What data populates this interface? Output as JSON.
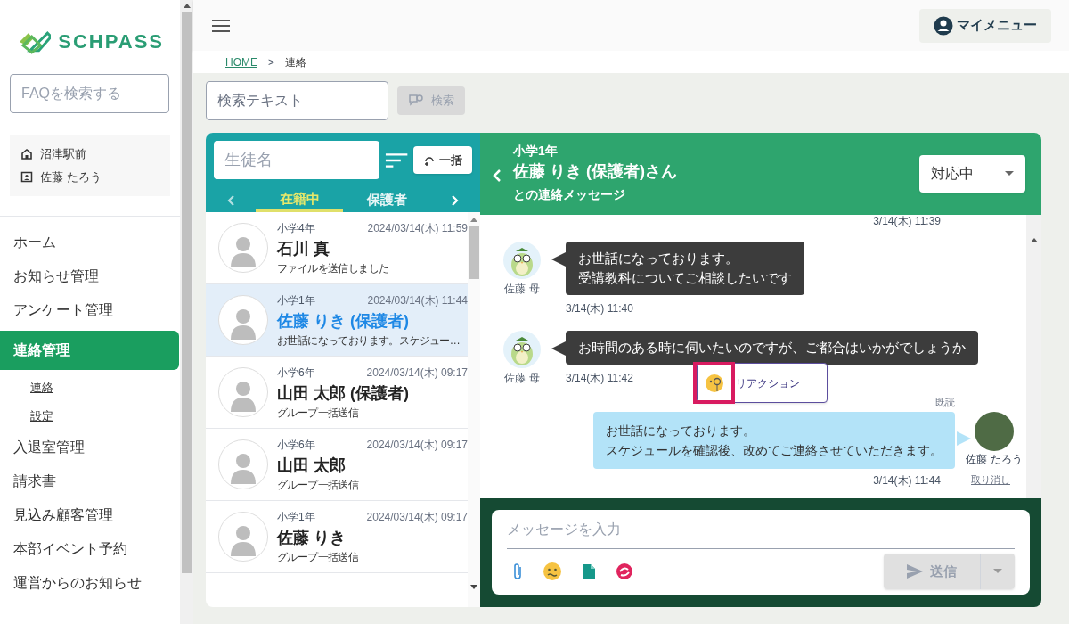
{
  "sidebar": {
    "logo_text": "SCHPASS",
    "faq_placeholder": "FAQを検索する",
    "school": "沼津駅前",
    "user": "佐藤 たろう",
    "nav": [
      {
        "label": "ホーム",
        "selected": false
      },
      {
        "label": "お知らせ管理",
        "selected": false
      },
      {
        "label": "アンケート管理",
        "selected": false
      },
      {
        "label": "連絡管理",
        "selected": true,
        "children": [
          {
            "label": "連絡"
          },
          {
            "label": "設定"
          }
        ]
      },
      {
        "label": "入退室管理",
        "selected": false
      },
      {
        "label": "請求書",
        "selected": false
      },
      {
        "label": "見込み顧客管理",
        "selected": false
      },
      {
        "label": "本部イベント予約",
        "selected": false
      },
      {
        "label": "運営からのお知らせ",
        "selected": false
      }
    ]
  },
  "header": {
    "my_menu": "マイメニュー"
  },
  "breadcrumb": {
    "items": [
      "HOME",
      "連絡"
    ],
    "separator": ">"
  },
  "search": {
    "placeholder": "検索テキスト",
    "button": "検索",
    "disabled": true
  },
  "student_list": {
    "placeholder": "生徒名",
    "bulk_button": "一括",
    "tabs": [
      {
        "label": "在籍中",
        "selected": true
      },
      {
        "label": "保護者",
        "selected": false
      }
    ],
    "rows": [
      {
        "grade": "小学4年",
        "datetime": "2024/03/14(木) 11:59",
        "name": "石川 真",
        "preview": "ファイルを送信しました",
        "selected": false
      },
      {
        "grade": "小学1年",
        "datetime": "2024/03/14(木) 11:44",
        "name": "佐藤 りき (保護者)",
        "preview": "お世話になっております。スケジュー…",
        "selected": true
      },
      {
        "grade": "小学6年",
        "datetime": "2024/03/14(木) 09:17",
        "name": "山田 太郎 (保護者)",
        "preview": "グループ一括送信",
        "selected": false
      },
      {
        "grade": "小学6年",
        "datetime": "2024/03/14(木) 09:17",
        "name": "山田 太郎",
        "preview": "グループ一括送信",
        "selected": false
      },
      {
        "grade": "小学1年",
        "datetime": "2024/03/14(木) 09:17",
        "name": "佐藤 りき",
        "preview": "グループ一括送信",
        "selected": false
      }
    ]
  },
  "chat": {
    "grade": "小学1年",
    "title": "佐藤 りき (保護者)さん",
    "subtitle": "との連絡メッセージ",
    "status": "対応中",
    "messages": [
      {
        "kind": "time_only",
        "time": "3/14(木) 11:39"
      },
      {
        "kind": "incoming",
        "sender": "佐藤 母",
        "lines": [
          "お世話になっております。",
          "受講教科についてご相談したいです"
        ],
        "time": "3/14(木) 11:40"
      },
      {
        "kind": "incoming",
        "sender": "佐藤 母",
        "lines": [
          "お時間のある時に伺いたいのですが、ご都合はいかがでしょうか"
        ],
        "time": "3/14(木) 11:42",
        "reaction": "リアクション"
      },
      {
        "kind": "outgoing",
        "read": "既読",
        "sender": "佐藤 たろう",
        "lines": [
          "お世話になっております。",
          "スケジュールを確認後、改めてご連絡させていただきます。"
        ],
        "time": "3/14(木) 11:44",
        "undo": "取り消し"
      }
    ],
    "composer": {
      "placeholder": "メッセージを入力",
      "send": "送信",
      "send_disabled": true
    }
  }
}
